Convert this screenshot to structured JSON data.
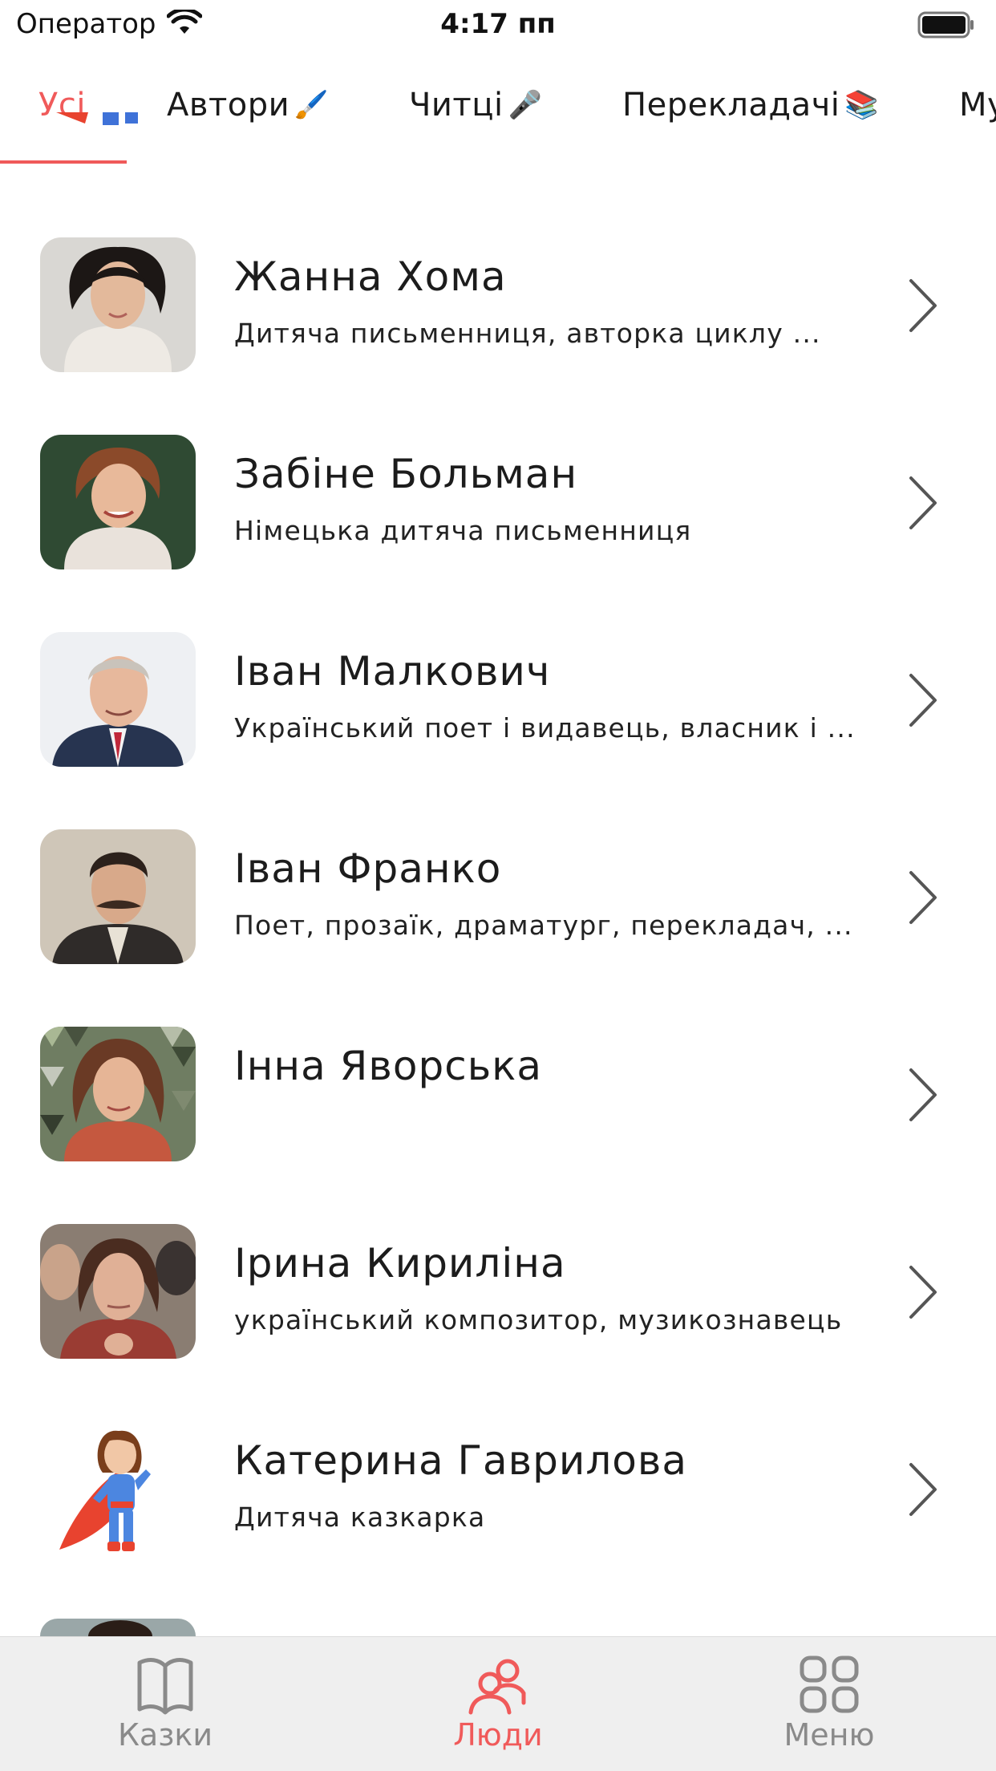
{
  "status_bar": {
    "carrier": "Оператор",
    "time": "4:17 пп"
  },
  "tabs": [
    {
      "label": "Усі",
      "emoji": "",
      "active": true
    },
    {
      "label": "Автори",
      "emoji": "🖌️"
    },
    {
      "label": "Читці",
      "emoji": "🎤"
    },
    {
      "label": "Перекладачі",
      "emoji": "📚"
    },
    {
      "label": "Му",
      "emoji": ""
    }
  ],
  "people": [
    {
      "name": "Жанна Хома",
      "description": "Дитяча письменниця, авторка циклу ...",
      "avatar": "photo-woman-dark-hair"
    },
    {
      "name": "Забіне Больман",
      "description": "Німецька дитяча письменниця",
      "avatar": "photo-woman-green-background"
    },
    {
      "name": "Іван Малкович",
      "description": "Український поет і видавець, власник і ...",
      "avatar": "photo-man-suit"
    },
    {
      "name": "Іван Франко",
      "description": "Поет, прозаїк, драматург, перекладач, ...",
      "avatar": "photo-man-mustache"
    },
    {
      "name": "Інна Яворська",
      "description": "",
      "avatar": "photo-woman-mosaic"
    },
    {
      "name": "Ірина Кириліна",
      "description": "український композитор, музикознавець",
      "avatar": "photo-woman-crowd"
    },
    {
      "name": "Катерина Гаврилова",
      "description": "Дитяча казкарка",
      "avatar": "superhero-girl-illustration"
    }
  ],
  "tabbar": {
    "items": [
      {
        "label": "Казки",
        "icon": "book-icon",
        "active": false
      },
      {
        "label": "Люди",
        "icon": "people-icon",
        "active": true
      },
      {
        "label": "Меню",
        "icon": "grid-icon",
        "active": false
      }
    ]
  },
  "colors": {
    "accent": "#f05a5a",
    "inactive": "#8a8a8a",
    "tabbar_bg": "#efefef"
  }
}
